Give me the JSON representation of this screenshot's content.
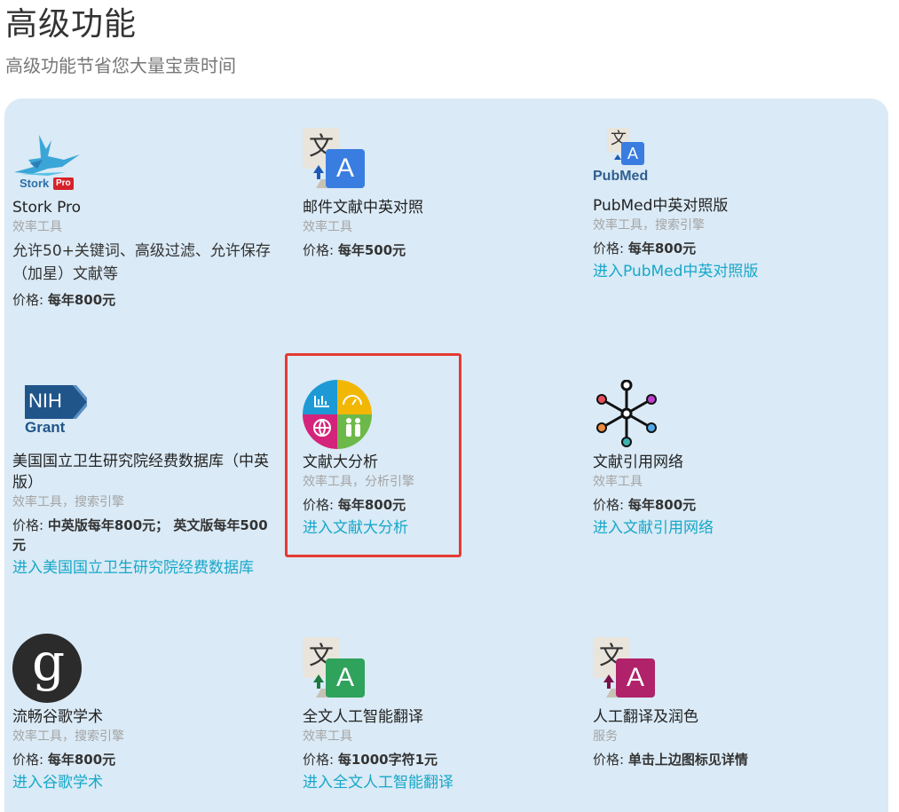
{
  "header": {
    "title": "高级功能",
    "subtitle": "高级功能节省您大量宝贵时间"
  },
  "cards": [
    {
      "icon": "stork-pro-logo",
      "logo_text": "Stork",
      "logo_badge": "Pro",
      "title": "Stork Pro",
      "tags": "效率工具",
      "desc": "允许50+关键词、高级过滤、允许保存（加星）文献等",
      "price_label": "价格: ",
      "price": "每年800元",
      "link": ""
    },
    {
      "icon": "translate-icon",
      "title": "邮件文献中英对照",
      "tags": "效率工具",
      "desc": "",
      "price_label": "价格: ",
      "price": "每年500元",
      "link": ""
    },
    {
      "icon": "pubmed-translate-icon",
      "logo_text": "PubMed",
      "title": "PubMed中英对照版",
      "tags": "效率工具，搜索引擎",
      "desc": "",
      "price_label": "价格: ",
      "price": "每年800元",
      "link": "进入PubMed中英对照版"
    },
    {
      "icon": "nih-grant-logo",
      "logo_text": "NIH",
      "logo_sub": "Grant",
      "title": "美国国立卫生研究院经费数据库（中英版）",
      "tags": "效率工具，搜索引擎",
      "desc": "",
      "price_label": "价格: ",
      "price": "中英版每年800元； 英文版每年500元",
      "link": "进入美国国立卫生研究院经费数据库"
    },
    {
      "icon": "analytics-icon",
      "title": "文献大分析",
      "tags": "效率工具，分析引擎",
      "desc": "",
      "price_label": "价格: ",
      "price": "每年800元",
      "link": "进入文献大分析"
    },
    {
      "icon": "network-icon",
      "title": "文献引用网络",
      "tags": "效率工具",
      "desc": "",
      "price_label": "价格: ",
      "price": "每年800元",
      "link": "进入文献引用网络"
    },
    {
      "icon": "google-scholar-icon",
      "title": "流畅谷歌学术",
      "tags": "效率工具，搜索引擎",
      "desc": "",
      "price_label": "价格: ",
      "price": "每年800元",
      "link": "进入谷歌学术"
    },
    {
      "icon": "translate-green-icon",
      "title": "全文人工智能翻译",
      "tags": "效率工具",
      "desc": "",
      "price_label": "价格: ",
      "price": "每1000字符1元",
      "link": "进入全文人工智能翻译"
    },
    {
      "icon": "translate-magenta-icon",
      "title": "人工翻译及润色",
      "tags": "服务",
      "desc": "",
      "price_label": "价格: ",
      "price": "单击上边图标见详情",
      "link": ""
    }
  ],
  "icon_glyphs": {
    "wen": "文",
    "a": "A",
    "g": "g"
  },
  "colors": {
    "panel_bg": "#daeaf6",
    "link": "#17a8c9",
    "highlight": "#e53a33",
    "translate_blue": "#3a7de0",
    "translate_green": "#2fa25b",
    "translate_magenta": "#b0226a"
  }
}
